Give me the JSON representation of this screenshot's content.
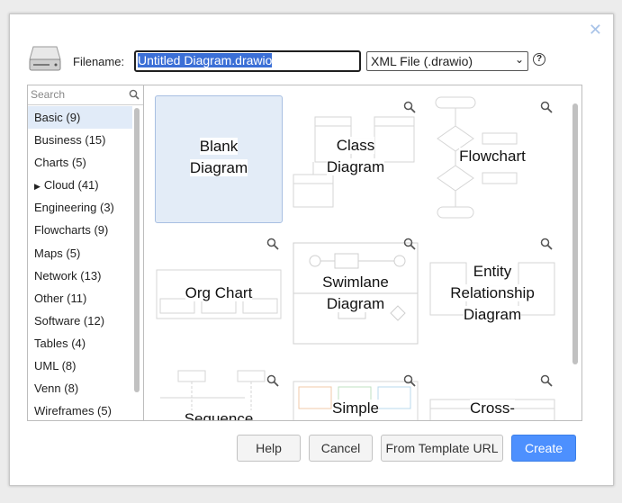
{
  "dialog": {
    "close_icon": "close-icon",
    "filename_label": "Filename:",
    "filename_value": "Untitled Diagram.drawio",
    "format_selected": "XML File (.drawio)",
    "help_glyph": "?"
  },
  "sidebar": {
    "search_placeholder": "Search",
    "categories": [
      {
        "label": "Basic (9)"
      },
      {
        "label": "Business (15)"
      },
      {
        "label": "Charts (5)"
      },
      {
        "label": "Cloud (41)"
      },
      {
        "label": "Engineering (3)"
      },
      {
        "label": "Flowcharts (9)"
      },
      {
        "label": "Maps (5)"
      },
      {
        "label": "Network (13)"
      },
      {
        "label": "Other (11)"
      },
      {
        "label": "Software (12)"
      },
      {
        "label": "Tables (4)"
      },
      {
        "label": "UML (8)"
      },
      {
        "label": "Venn (8)"
      },
      {
        "label": "Wireframes (5)"
      }
    ]
  },
  "templates": [
    {
      "line1": "Blank",
      "line2": "Diagram"
    },
    {
      "line1": "Class",
      "line2": "Diagram"
    },
    {
      "line1": "Flowchart"
    },
    {
      "line1": "Org Chart"
    },
    {
      "line1": "Swimlane",
      "line2": "Diagram"
    },
    {
      "line1": "Entity",
      "line2": "Relationship",
      "line3": "Diagram"
    },
    {
      "line1": "Sequence"
    },
    {
      "line1": "Simple"
    },
    {
      "line1": "Cross-"
    }
  ],
  "buttons": {
    "help": "Help",
    "cancel": "Cancel",
    "template_url": "From Template URL",
    "create": "Create"
  },
  "colors": {
    "accent": "#4d90fe",
    "selection": "#3b6fd6",
    "active_category": "#e1ebf8"
  }
}
